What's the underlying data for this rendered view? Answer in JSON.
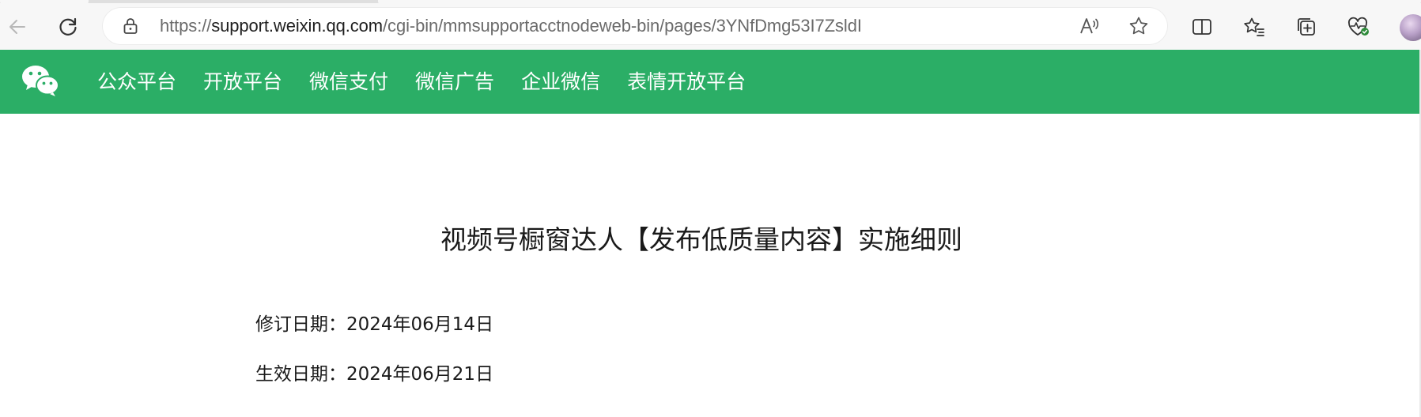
{
  "browser": {
    "url_prefix": "https://",
    "url_host": "support.weixin.qq.com",
    "url_path": "/cgi-bin/mmsupportacctnodeweb-bin/pages/3YNfDmg53I7ZsldI"
  },
  "site": {
    "nav": [
      "公众平台",
      "开放平台",
      "微信支付",
      "微信广告",
      "企业微信",
      "表情开放平台"
    ]
  },
  "article": {
    "title": "视频号橱窗达人【发布低质量内容】实施细则",
    "revision_label": "修订日期：",
    "revision_date": "2024年06月14日",
    "effective_label": "生效日期：",
    "effective_date": "2024年06月21日"
  },
  "colors": {
    "header_green": "#2bae66"
  }
}
